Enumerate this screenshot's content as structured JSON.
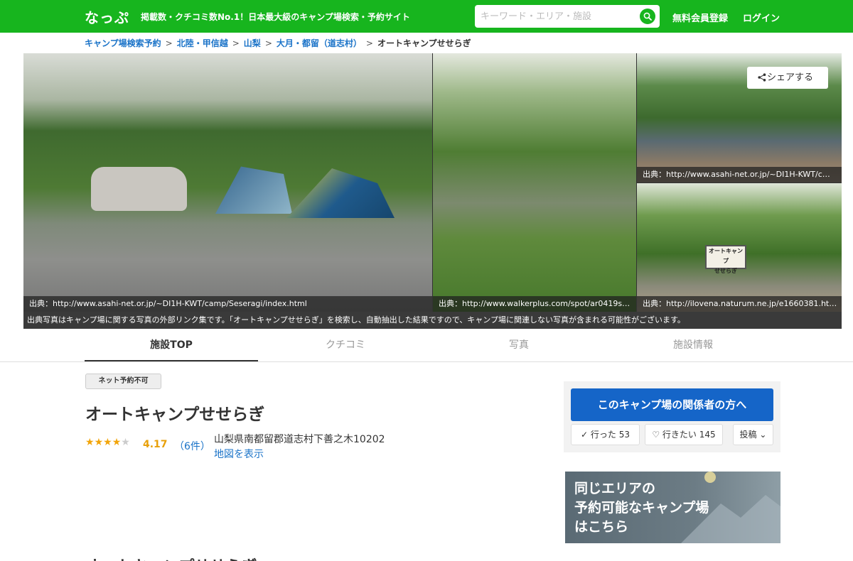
{
  "header": {
    "logo": "なっぷ",
    "tagline": "掲載数・クチコミ数No.1！日本最大級のキャンプ場検索・予約サイト",
    "search_placeholder": "キーワード・エリア・施設",
    "register_label": "無料会員登録",
    "login_label": "ログイン",
    "brand_color": "#17b51e"
  },
  "breadcrumb": {
    "items": [
      "キャンプ場検索予約",
      "北陸・甲信越",
      "山梨",
      "大月・都留（道志村）"
    ],
    "separator": ">",
    "current": "オートキャンプせせらぎ"
  },
  "gallery": {
    "photos": [
      {
        "credit": "出典：http://www.asahi-net.or.jp/~DI1H-KWT/camp/Seseragi/index.html"
      },
      {
        "credit": "出典：http://www.walkerplus.com/spot/ar0419s…"
      },
      {
        "credit": "出典：http://www.asahi-net.or.jp/~DI1H-KWT/c…"
      },
      {
        "credit": "出典：http://ilovena.naturum.ne.jp/e1660381.ht…"
      }
    ],
    "disclaimer": "出典写真はキャンプ場に関する写真の外部リンク集です。「オートキャンプせせらぎ」を検索し、自動抽出した結果ですので、キャンプ場に関連しない写真が含まれる可能性がございます。",
    "share_label": "シェアする",
    "sign_text_line1": "オートキャンプ",
    "sign_text_line2": "せせらぎ"
  },
  "tabs": [
    {
      "label": "施設TOP",
      "active": true
    },
    {
      "label": "クチコミ",
      "active": false
    },
    {
      "label": "写真",
      "active": false
    },
    {
      "label": "施設情報",
      "active": false
    }
  ],
  "facility": {
    "badge": "ネット予約不可",
    "name": "オートキャンプせせらぎ",
    "stars": 4.17,
    "rating": "4.17",
    "review_count": "（6件）",
    "address": "山梨県南都留郡道志村下善之木10202",
    "map_link": "地図を表示",
    "section_title": "オートキャンプせせらぎ"
  },
  "side": {
    "owner_button": "このキャンプ場の関係者の方へ",
    "went_label": "行った",
    "went_count": "53",
    "want_label": "行きたい",
    "want_count": "145",
    "post_label": "投稿",
    "accent_color": "#1565c8"
  },
  "promo": {
    "line1": "同じエリアの",
    "line2": "予約可能なキャンプ場",
    "line3": "はこちら"
  }
}
